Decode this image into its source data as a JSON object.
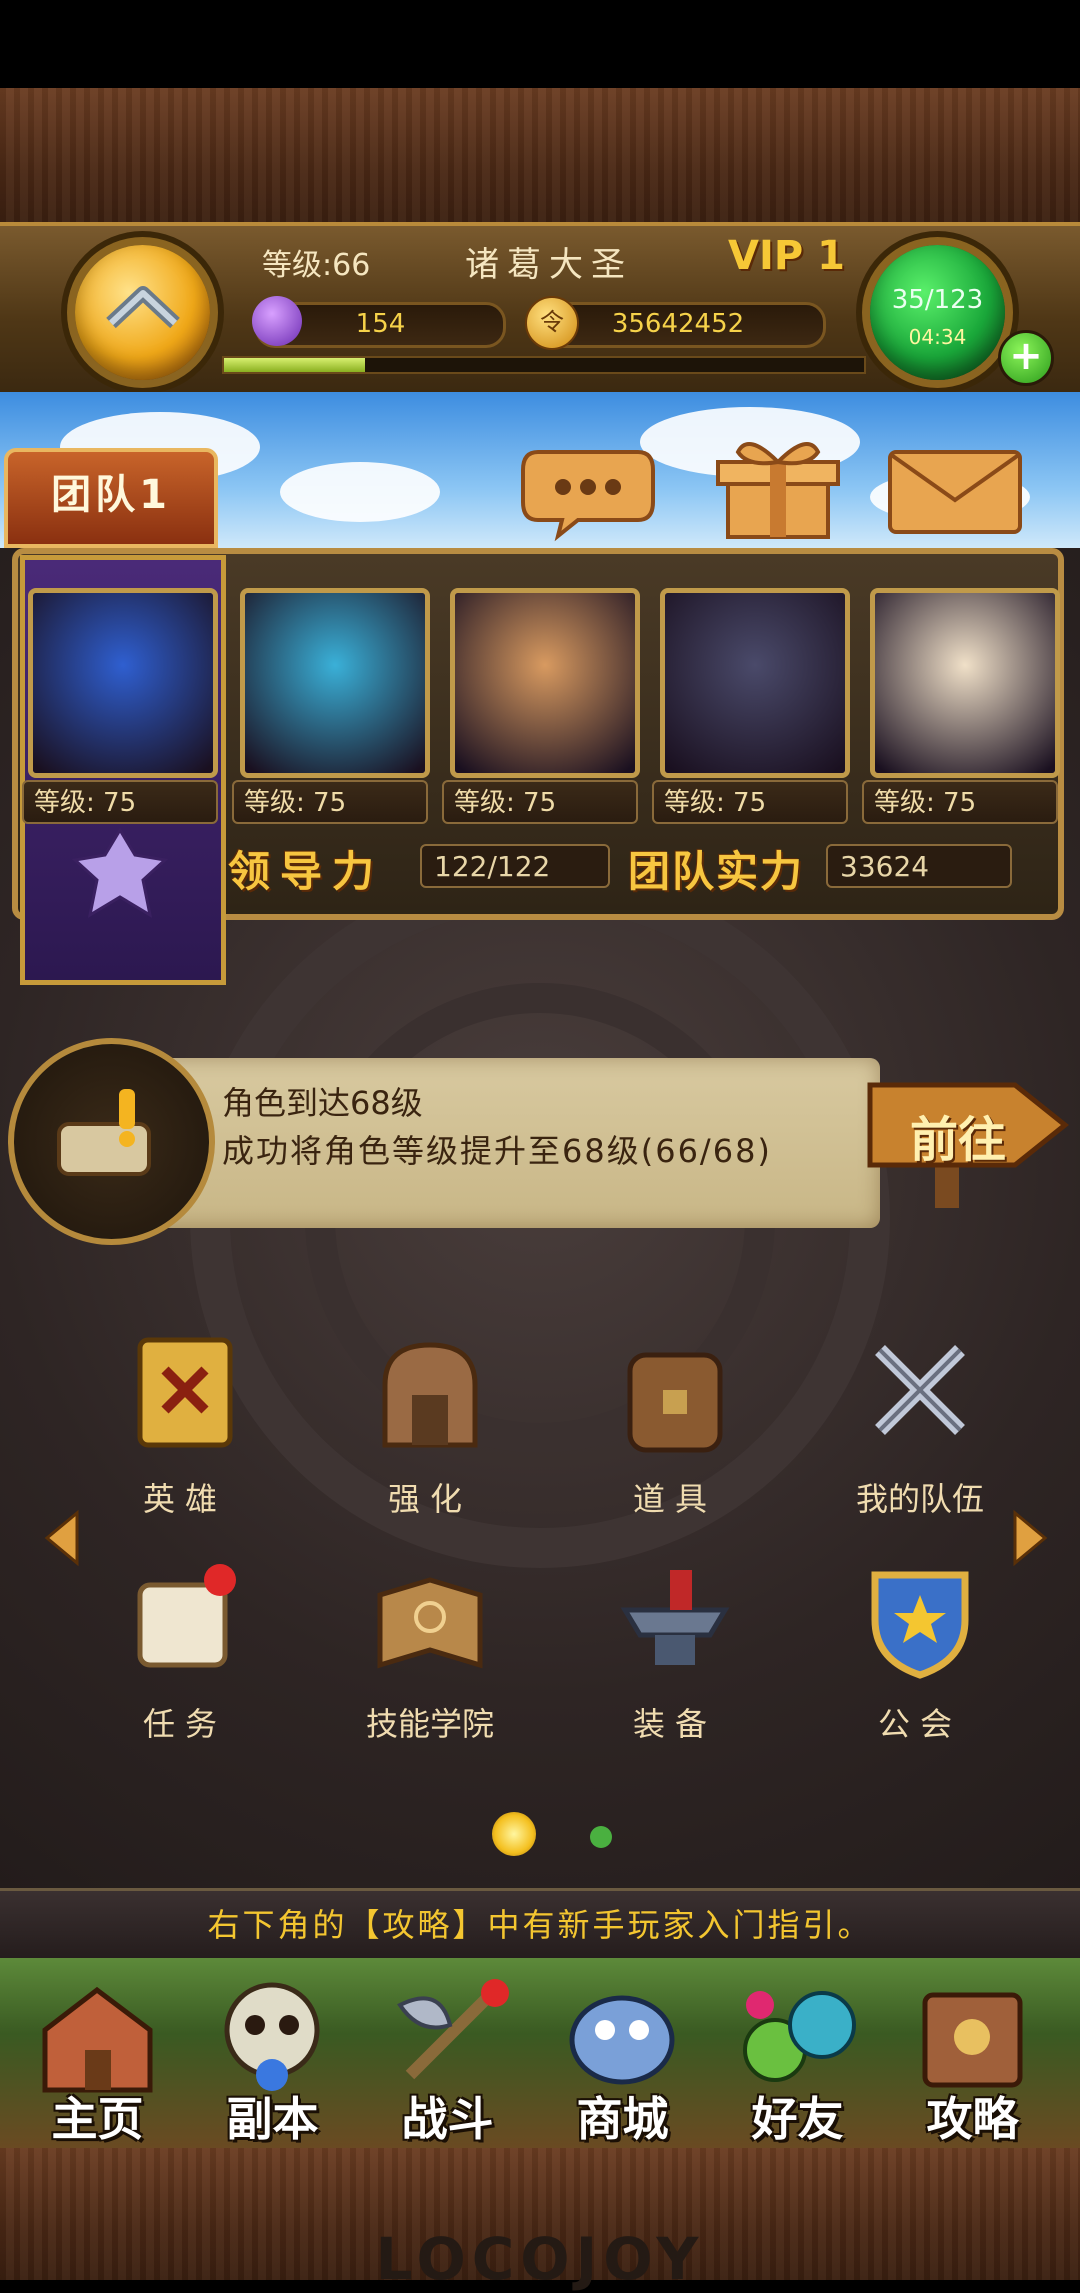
{
  "header": {
    "level_label": "等级:66",
    "player_name": "诸葛大圣",
    "vip_label": "VIP 1",
    "gems": "154",
    "gold": "35642452",
    "energy": "35/123",
    "energy_timer": "04:34",
    "exp_progress": 0.22
  },
  "toolbar": {
    "team_tab": "团队1"
  },
  "heroes": [
    {
      "level": "等级: 75",
      "color": "#2f5fd0"
    },
    {
      "level": "等级: 75",
      "color": "#3ab0d8"
    },
    {
      "level": "等级: 75",
      "color": "#d89a60"
    },
    {
      "level": "等级: 75",
      "color": "#4a4a6a"
    },
    {
      "level": "等级: 75",
      "color": "#f0e0c8"
    }
  ],
  "team_stats": {
    "leadership_label": "领导力",
    "leadership_value": "122/122",
    "power_label": "团队实力",
    "power_value": "33624"
  },
  "quest": {
    "title": "角色到达68级",
    "description": "成功将角色等级提升至68级(66/68)",
    "go_label": "前往"
  },
  "menu": [
    {
      "label": "英雄",
      "icon": "hero-card-icon"
    },
    {
      "label": "强化",
      "icon": "forge-icon"
    },
    {
      "label": "道具",
      "icon": "backpack-icon"
    },
    {
      "label": "我的队伍",
      "icon": "crossed-swords-icon"
    },
    {
      "label": "任务",
      "icon": "scroll-icon"
    },
    {
      "label": "技能学院",
      "icon": "spellbook-icon"
    },
    {
      "label": "装备",
      "icon": "anvil-icon"
    },
    {
      "label": "公会",
      "icon": "shield-crest-icon"
    }
  ],
  "page_indicator": {
    "current": 1,
    "total": 2
  },
  "tip": "右下角的【攻略】中有新手玩家入门指引。",
  "nav": [
    {
      "label": "主页",
      "icon": "house-icon"
    },
    {
      "label": "副本",
      "icon": "skull-icon"
    },
    {
      "label": "战斗",
      "icon": "battle-axe-icon"
    },
    {
      "label": "商城",
      "icon": "shop-monster-icon"
    },
    {
      "label": "好友",
      "icon": "friends-icon"
    },
    {
      "label": "攻略",
      "icon": "guide-book-icon"
    }
  ],
  "logo": "LOCOJOY"
}
